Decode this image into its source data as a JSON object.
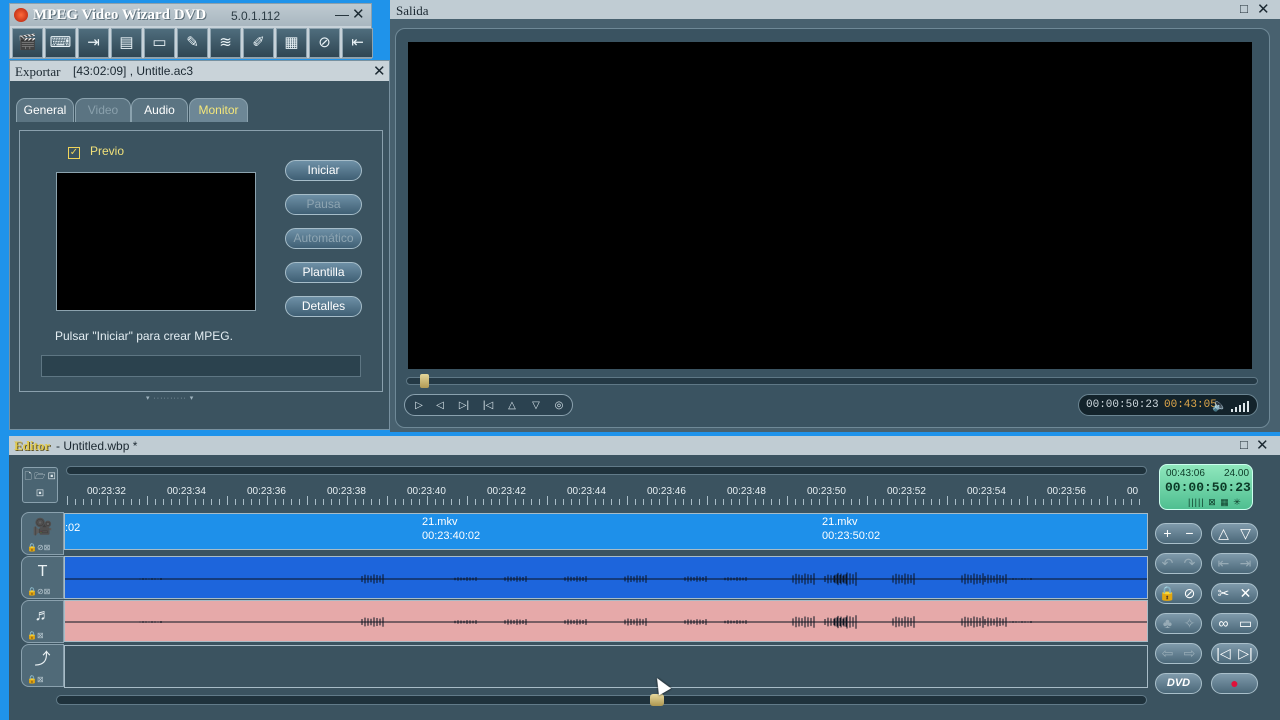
{
  "app": {
    "title": "MPEG Video Wizard DVD",
    "version": "5.0.1.112",
    "minimize": "—",
    "close": "✕",
    "toolbar_icons": [
      "clapper-icon",
      "keyboard-icon",
      "import-icon",
      "screen-icon",
      "cd-icon",
      "edit-icon",
      "dvd-icon",
      "effects-icon",
      "layout-icon",
      "disc-icon",
      "export-icon"
    ],
    "toolbar_glyphs": [
      "🎬",
      "⌨",
      "⇥",
      "▤",
      "▭",
      "✎",
      "≋",
      "✐",
      "▦",
      "⊘",
      "⇤"
    ]
  },
  "export": {
    "title": "Exportar",
    "subtitle": "[43:02:09] , Untitle.ac3",
    "close": "✕",
    "tabs": [
      {
        "label": "General",
        "state": "normal"
      },
      {
        "label": "Video",
        "state": "disabled"
      },
      {
        "label": "Audio",
        "state": "normal"
      },
      {
        "label": "Monitor",
        "state": "active"
      }
    ],
    "preview_label": "Previo",
    "preview_checked": "✓",
    "buttons": [
      {
        "label": "Iniciar",
        "state": "enabled"
      },
      {
        "label": "Pausa",
        "state": "disabled"
      },
      {
        "label": "Automático",
        "state": "disabled"
      },
      {
        "label": "Plantilla",
        "state": "enabled"
      },
      {
        "label": "Detalles",
        "state": "enabled"
      }
    ],
    "hint": "Pulsar \"Iniciar\" para crear MPEG.",
    "grip": "▾ ·········· ▾"
  },
  "output": {
    "title": "Salida",
    "maximize": "□",
    "close": "✕",
    "seek_position": 0.02,
    "transport": [
      "▷",
      "◁",
      "▷|",
      "|◁",
      "△",
      "▽",
      "◎"
    ],
    "current_time": "00:00:50:23",
    "duration": "00:43:05",
    "speaker": "🔈"
  },
  "editor": {
    "title": "Editor",
    "file": "- Untitled.wbp *",
    "maximize": "□",
    "close": "✕",
    "ruler": [
      "00:23:32",
      "00:23:34",
      "00:23:36",
      "00:23:38",
      "00:23:40",
      "00:23:42",
      "00:23:44",
      "00:23:46",
      "00:23:48",
      "00:23:50",
      "00:23:52",
      "00:23:54",
      "00:23:56",
      "00"
    ],
    "mini_tools": "🗋 🗁 ▣ ▣",
    "tracks": [
      {
        "icon": "🎥",
        "sub": "🔒⊘⊠"
      },
      {
        "icon": "T",
        "sub": "🔒⊘⊠"
      },
      {
        "icon": "♬",
        "sub": "🔒⊠"
      },
      {
        "icon": "⤴",
        "sub": "🔒⊠"
      }
    ],
    "clips": [
      {
        "line1": "",
        "line2": ":02"
      },
      {
        "line1": "21.mkv",
        "line2": "00:23:40:02"
      },
      {
        "line1": "21.mkv",
        "line2": "00:23:50:02"
      }
    ],
    "scroll_position": 0.55,
    "lcd": {
      "total": "00:43:06",
      "fps": "24.00",
      "time": "00:00:50:23",
      "marks": "||||| ⊠ ▦ ✳"
    },
    "right_buttons": [
      {
        "a": "+",
        "b": "−",
        "state": "enabled"
      },
      {
        "a": "△",
        "b": "▽",
        "state": "enabled"
      },
      {
        "a": "↶",
        "b": "↷",
        "state": "disabled"
      },
      {
        "a": "⇤",
        "b": "⇥",
        "state": "disabled"
      },
      {
        "a": "🔒",
        "b": "⊘",
        "state": "enabled"
      },
      {
        "a": "✂",
        "b": "✕",
        "state": "enabled"
      },
      {
        "a": "♣",
        "b": "✧",
        "state": "disabled"
      },
      {
        "a": "∞",
        "b": "▭",
        "state": "enabled"
      },
      {
        "a": "⇦",
        "b": "⇨",
        "state": "disabled"
      },
      {
        "a": "|◁",
        "b": "▷|",
        "state": "enabled"
      },
      {
        "a": "DVD",
        "b": "",
        "state": "enabled"
      },
      {
        "a": "●",
        "b": "",
        "state": "enabled"
      }
    ]
  }
}
